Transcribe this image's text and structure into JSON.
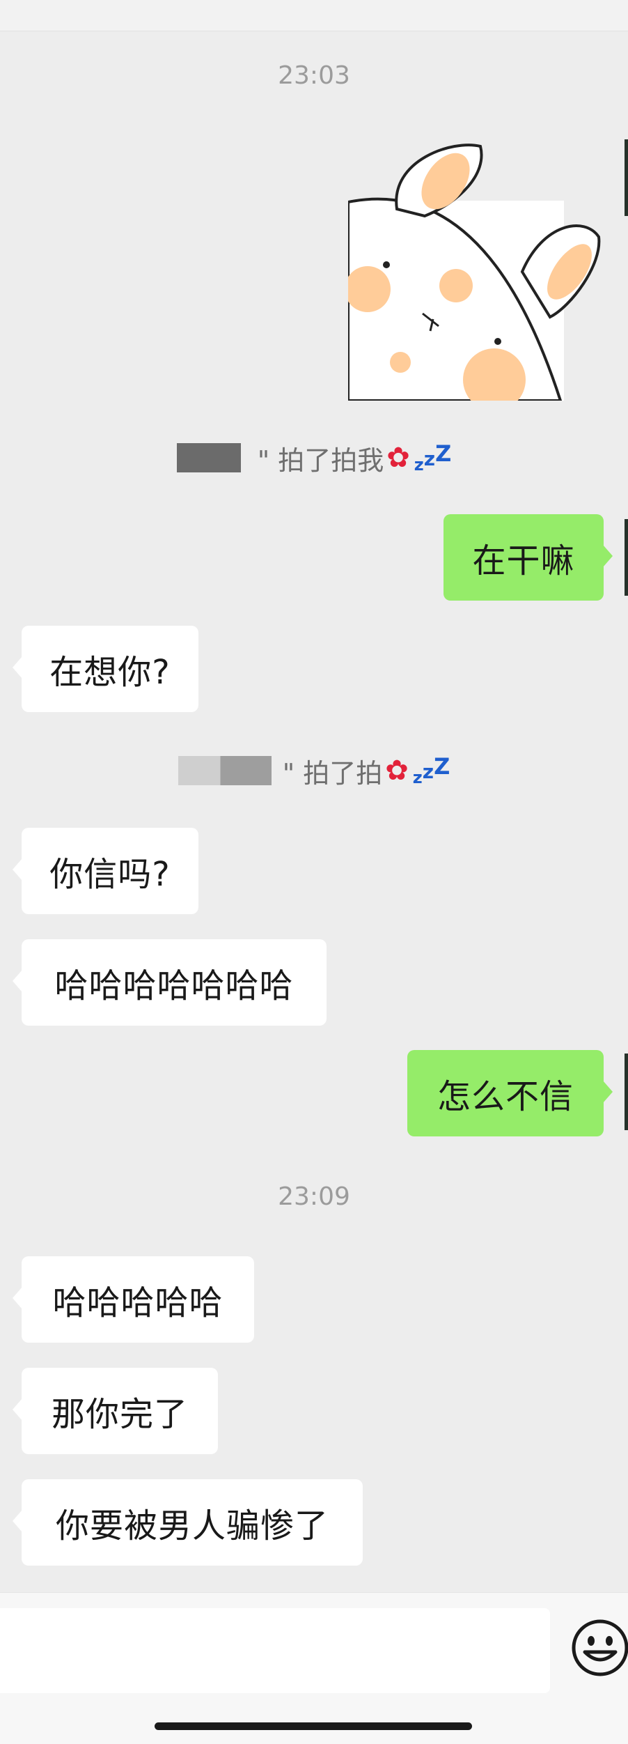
{
  "timestamps": [
    "23:03",
    "23:09"
  ],
  "sticker_icon": "sleepy-bunny-sticker",
  "system_messages": [
    {
      "text": "\" 拍了拍我",
      "emoji": "flower",
      "zzz": "zzZ"
    },
    {
      "text": "\" 拍了拍",
      "emoji": "flower",
      "zzz": "zzZ"
    }
  ],
  "messages": [
    {
      "side": "out",
      "text": "在干嘛"
    },
    {
      "side": "in",
      "text": "在想你?"
    },
    {
      "side": "in",
      "text": "你信吗?"
    },
    {
      "side": "in",
      "text": "哈哈哈哈哈哈哈"
    },
    {
      "side": "out",
      "text": "怎么不信"
    },
    {
      "side": "in",
      "text": "哈哈哈哈哈"
    },
    {
      "side": "in",
      "text": "那你完了"
    },
    {
      "side": "in",
      "text": "你要被男人骗惨了"
    }
  ],
  "input": {
    "value": ""
  },
  "icons": {
    "emoji": "smiley-face-icon"
  },
  "colors": {
    "background": "#ededed",
    "outgoing_bubble": "#95ec69",
    "incoming_bubble": "#ffffff"
  }
}
